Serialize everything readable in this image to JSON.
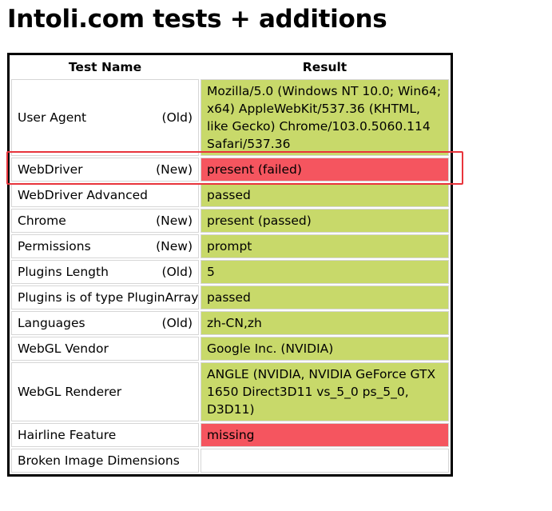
{
  "page": {
    "title": "Intoli.com tests + additions"
  },
  "table": {
    "headers": {
      "test_name": "Test Name",
      "result": "Result"
    },
    "rows": [
      {
        "name": "User Agent",
        "tag": "(Old)",
        "result": "Mozilla/5.0 (Windows NT 10.0; Win64; x64) AppleWebKit/537.36 (KHTML, like Gecko) Chrome/103.0.5060.114 Safari/537.36",
        "status": "passed"
      },
      {
        "name": "WebDriver",
        "tag": "(New)",
        "result": "present (failed)",
        "status": "failed"
      },
      {
        "name": "WebDriver Advanced",
        "tag": "",
        "result": "passed",
        "status": "passed"
      },
      {
        "name": "Chrome",
        "tag": "(New)",
        "result": "present (passed)",
        "status": "passed"
      },
      {
        "name": "Permissions",
        "tag": "(New)",
        "result": "prompt",
        "status": "passed"
      },
      {
        "name": "Plugins Length",
        "tag": "(Old)",
        "result": "5",
        "status": "passed"
      },
      {
        "name": "Plugins is of type PluginArray",
        "tag": "",
        "result": "passed",
        "status": "passed"
      },
      {
        "name": "Languages",
        "tag": "(Old)",
        "result": "zh-CN,zh",
        "status": "passed"
      },
      {
        "name": "WebGL Vendor",
        "tag": "",
        "result": "Google Inc. (NVIDIA)",
        "status": "passed"
      },
      {
        "name": "WebGL Renderer",
        "tag": "",
        "result": "ANGLE (NVIDIA, NVIDIA GeForce GTX 1650 Direct3D11 vs_5_0 ps_5_0, D3D11)",
        "status": "passed"
      },
      {
        "name": "Hairline Feature",
        "tag": "",
        "result": "missing",
        "status": "failed"
      },
      {
        "name": "Broken Image Dimensions",
        "tag": "",
        "result": "",
        "status": "empty"
      }
    ]
  },
  "colors": {
    "passed": "#c8d96a",
    "failed": "#f5555f",
    "highlight": "#e8343c"
  }
}
